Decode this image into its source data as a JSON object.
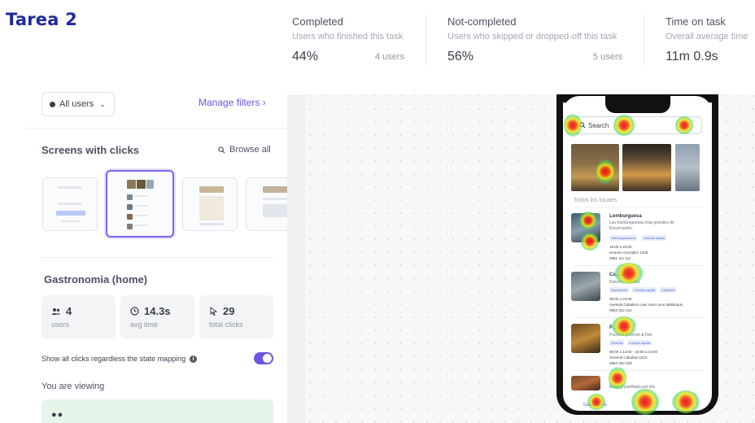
{
  "task_title": "Tarea 2",
  "stats": [
    {
      "title": "Completed",
      "subtitle": "Users who finished this task",
      "value": "44%",
      "count": "4 users"
    },
    {
      "title": "Not-completed",
      "subtitle": "Users who skipped or dropped-off this task",
      "value": "56%",
      "count": "5 users"
    },
    {
      "title": "Time on task",
      "subtitle": "Overall average time",
      "value": "11m 0.9s",
      "count": ""
    }
  ],
  "filters": {
    "all_users_label": "All users",
    "manage_filters_label": "Manage filters"
  },
  "screens": {
    "title": "Screens with clicks",
    "browse_all_label": "Browse all"
  },
  "screen_detail": {
    "name": "Gastronomia (home)",
    "metrics": [
      {
        "value": "4",
        "label": "users",
        "icon": "users-icon"
      },
      {
        "value": "14.3s",
        "label": "avg time",
        "icon": "clock-icon"
      },
      {
        "value": "29",
        "label": "total clicks",
        "icon": "cursor-icon"
      }
    ],
    "show_all_clicks_label": "Show all clicks regardless the state mapping",
    "show_all_clicks_enabled": true,
    "viewing_label": "You are viewing"
  },
  "phone": {
    "search_placeholder": "Search",
    "section_label": "Todos los locales",
    "restaurants": [
      {
        "name": "Lomburguesa",
        "desc": "Las hamburguesas más grandes de Encarnación",
        "tags": [
          "Hamburguesería",
          "Comida rápida"
        ],
        "hours": "18:00 a 23:00",
        "address": "Honorio González 1245",
        "phone": "0961 111 111"
      },
      {
        "name": "Ca…ez",
        "desc": "Dulces y salados",
        "tags": [
          "Repostería",
          "Comida rápida",
          "Cafetería"
        ],
        "hours": "08:00 a 23:00",
        "address": "Avenida Caballero casi Juan Leon Mallorquin",
        "phone": "0962 222 222"
      },
      {
        "name": "P…",
        "desc": "Pizzería gourmet & Deli",
        "tags": [
          "Pizzería",
          "Comida rápida"
        ],
        "hours": "08:00 a 13:00 - 18:00 a 23:00",
        "address": "General Cabañas 1623",
        "phone": "0963 333 333"
      },
      {
        "name": "",
        "desc": "Buffet y parrillada por kilo",
        "tags": [],
        "hours": "",
        "address": "",
        "phone": ""
      }
    ],
    "bottom_nav_label": "Gastronomía"
  },
  "colors": {
    "brand": "#1f2a9b",
    "accent": "#6a56e0",
    "viewing_bg": "#e6f4ea"
  }
}
